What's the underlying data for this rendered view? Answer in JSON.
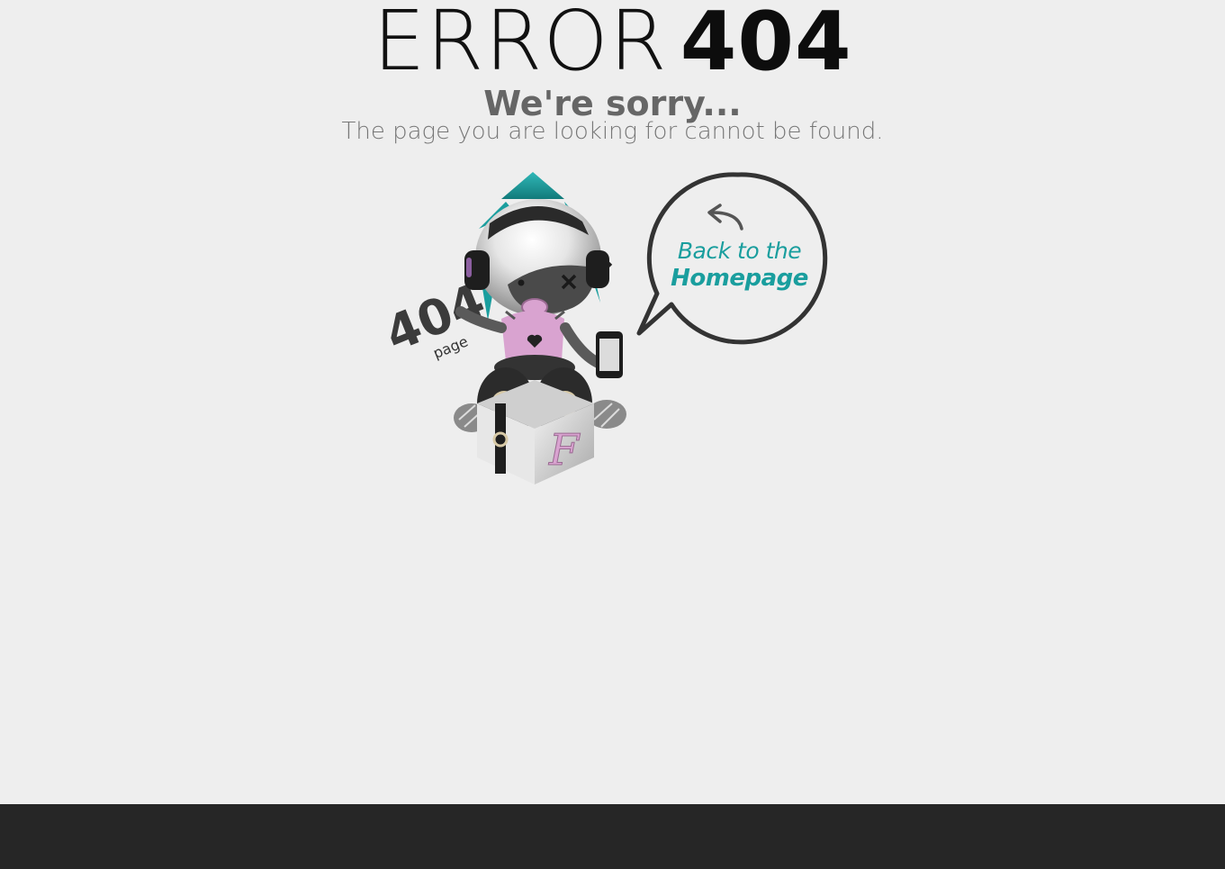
{
  "header": {
    "error_word": "ERROR",
    "error_code": "404"
  },
  "message": {
    "sorry": "We're sorry...",
    "detail": "The page you are looking for cannot be found."
  },
  "mascot": {
    "badge_number": "404",
    "badge_word": "page",
    "book_letter": "F"
  },
  "home_link": {
    "line1": "Back to the",
    "line2": "Homepage",
    "icon": "back-arrow-icon"
  },
  "colors": {
    "background": "#eeeeee",
    "accent": "#1a9e9e",
    "footer": "#262626",
    "pink": "#d9a3d0"
  }
}
